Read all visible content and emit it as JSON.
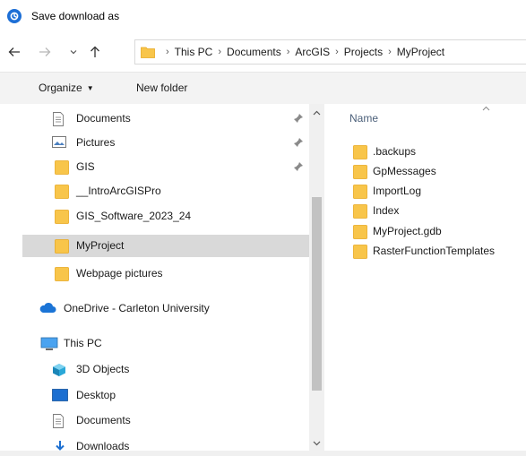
{
  "window": {
    "title": "Save download as"
  },
  "address": {
    "crumbs": [
      "This PC",
      "Documents",
      "ArcGIS",
      "Projects",
      "MyProject"
    ]
  },
  "toolbar": {
    "organize_label": "Organize",
    "new_folder_label": "New folder"
  },
  "nav": {
    "items": [
      {
        "label": "Documents",
        "icon": "document-icon",
        "pinned": true
      },
      {
        "label": "Pictures",
        "icon": "pictures-icon",
        "pinned": true
      },
      {
        "label": "GIS",
        "icon": "folder-icon",
        "pinned": true
      },
      {
        "label": "__IntroArcGISPro",
        "icon": "folder-icon",
        "pinned": false
      },
      {
        "label": "GIS_Software_2023_24",
        "icon": "folder-icon",
        "pinned": false
      },
      {
        "label": "MyProject",
        "icon": "folder-icon",
        "pinned": false,
        "selected": true
      },
      {
        "label": "Webpage pictures",
        "icon": "folder-icon",
        "pinned": false
      },
      {
        "label": "OneDrive - Carleton University",
        "icon": "onedrive-icon",
        "pinned": false
      },
      {
        "label": "This PC",
        "icon": "this-pc-icon",
        "pinned": false
      },
      {
        "label": "3D Objects",
        "icon": "3d-objects-icon",
        "pinned": false
      },
      {
        "label": "Desktop",
        "icon": "desktop-icon",
        "pinned": false
      },
      {
        "label": "Documents",
        "icon": "document-icon",
        "pinned": false
      },
      {
        "label": "Downloads",
        "icon": "downloads-icon",
        "pinned": false
      }
    ]
  },
  "content": {
    "column_header": "Name",
    "files": [
      {
        "label": ".backups",
        "icon": "folder-icon"
      },
      {
        "label": "GpMessages",
        "icon": "folder-icon"
      },
      {
        "label": "ImportLog",
        "icon": "folder-icon"
      },
      {
        "label": "Index",
        "icon": "folder-icon"
      },
      {
        "label": "MyProject.gdb",
        "icon": "folder-icon"
      },
      {
        "label": "RasterFunctionTemplates",
        "icon": "folder-icon"
      }
    ]
  },
  "colors": {
    "folder": "#f8c54a",
    "folder_dark": "#e8a820",
    "selected_bg": "#d9d9d9",
    "accent": "#1d6fd6"
  }
}
